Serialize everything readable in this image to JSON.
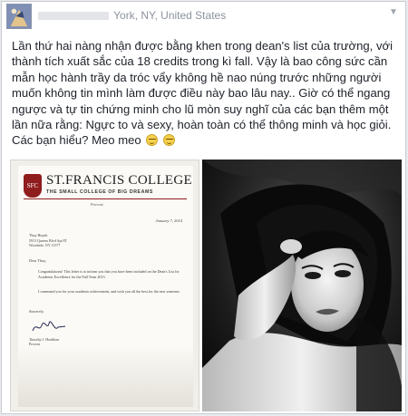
{
  "post": {
    "location": "York, NY, United States",
    "body": "Lần thứ hai nàng nhận được bằng khen trong dean's list của trường, với thành tích xuất sắc của 18 credits trong kì fall. Vậy là bao công sức cần mẫn học hành trầy da tróc vẩy không hề nao núng trước những người muốn không tin mình làm được điều này bao lâu nay.. Giờ có thể ngang ngược và tự tin chứng minh cho lũ mòn suy nghĩ của các bạn thêm một lần nữa rằng: Ngực to và sexy, hoàn toàn có thể thông minh và học giỏi. Các bạn hiểu? Meo meo"
  },
  "letter": {
    "college_name": "ST.FRANCIS COLLEGE",
    "college_tagline": "THE SMALL COLLEGE OF BIG DREAMS",
    "seal_text": "SFC",
    "office": "Provost",
    "date": "January 7, 2014",
    "address_lines": [
      "Thuy Huynh",
      "5913 Queens Blvd Apt 8T",
      "Woodside, NY 11377"
    ],
    "salutation": "Dear Thuy,",
    "paragraph1": "Congratulations! This letter is to inform you that you have been included on the Dean's List for Academic Excellence for the Fall Term 2013.",
    "paragraph2": "I commend you for your academic achievement, and wish you all the best for the new semester.",
    "closing": "Sincerely,",
    "signer_name": "Timothy J. Houlihan",
    "signer_title": "Provost"
  },
  "icons": {
    "chevron": "chevron-down-icon",
    "emoji": "smiley-icon"
  },
  "colors": {
    "college_red": "#8f1d1d",
    "meta_gray": "#8c929d",
    "text": "#1d2129"
  }
}
